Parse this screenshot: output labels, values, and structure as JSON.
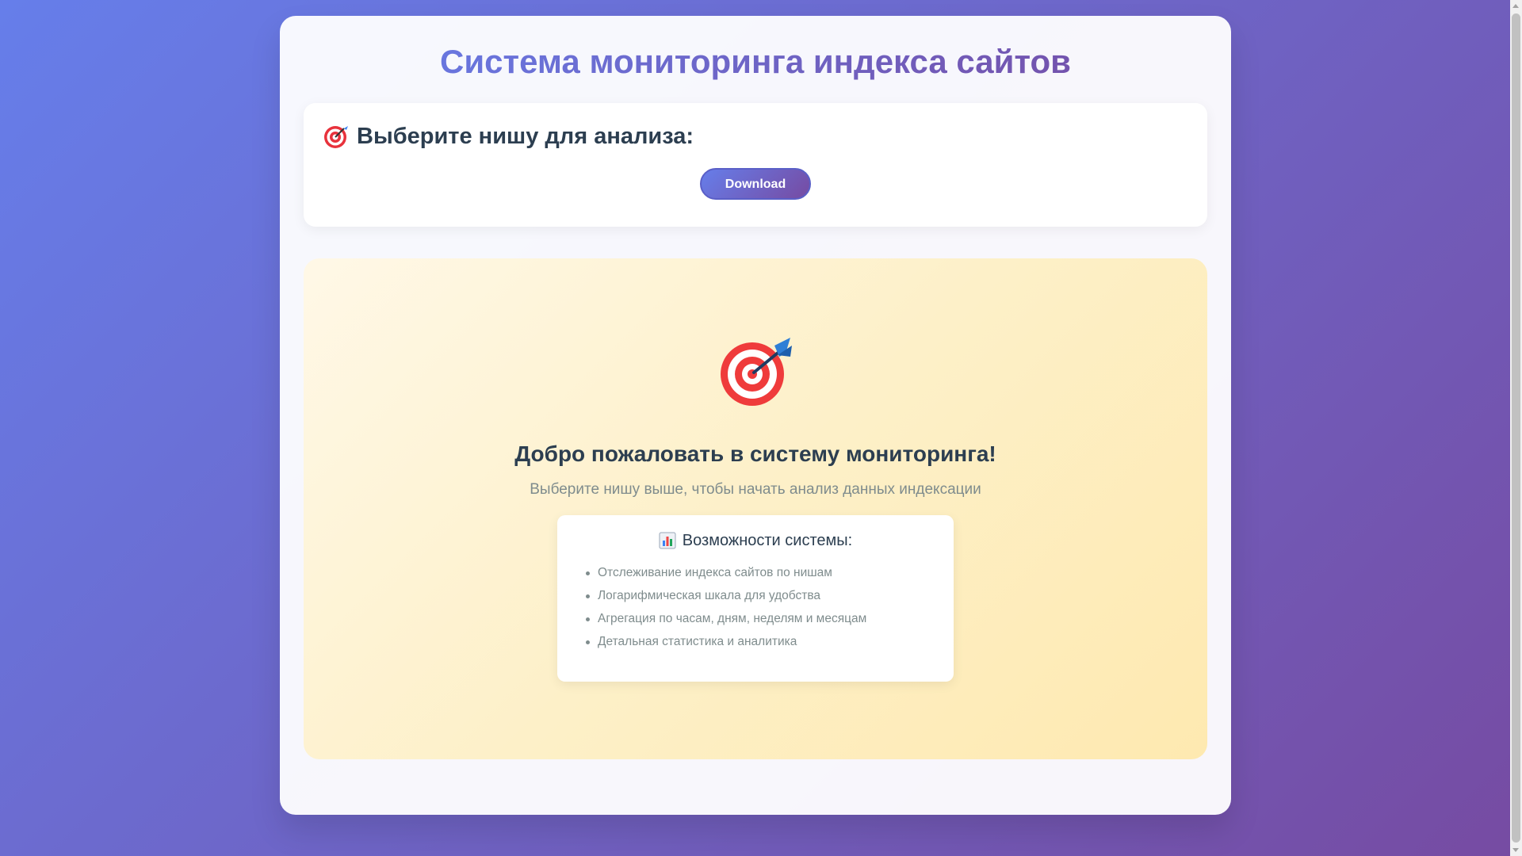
{
  "header": {
    "title": "Система мониторинга индекса сайтов"
  },
  "niche": {
    "heading": "Выберите нишу для анализа:",
    "icon": "target-icon",
    "download_label": "Download"
  },
  "welcome": {
    "icon": "target-icon",
    "title": "Добро пожаловать в систему мониторинга!",
    "subtitle": "Выберите нишу выше, чтобы начать анализ данных индексации",
    "features": {
      "icon": "bar-chart-icon",
      "heading": "Возможности системы:",
      "items": [
        "Отслеживание индекса сайтов по нишам",
        "Логарифмическая шкала для удобства",
        "Агрегация по часам, дням, неделям и месяцам",
        "Детальная статистика и аналитика"
      ]
    }
  },
  "colors": {
    "accent_start": "#667eea",
    "accent_end": "#764ba2",
    "text_dark": "#2c3e50",
    "text_muted": "#7f8c8d",
    "welcome_bg": "#fdf0c8"
  }
}
